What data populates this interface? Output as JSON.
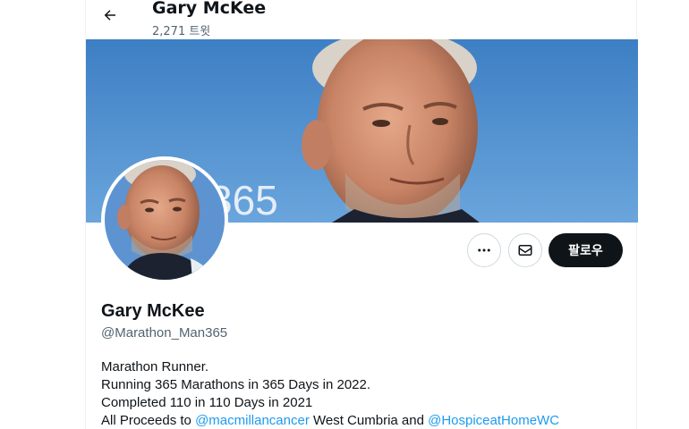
{
  "header": {
    "name": "Gary McKee",
    "tweet_count": "2,271 트윗"
  },
  "banner": {
    "overlay_text": "365"
  },
  "actions": {
    "more_icon": "more-horizontal-icon",
    "message_icon": "envelope-icon",
    "follow_label": "팔로우"
  },
  "profile": {
    "name": "Gary McKee",
    "handle": "@Marathon_Man365"
  },
  "bio": {
    "line1": "Marathon Runner.",
    "line2": "Running 365 Marathons in 365 Days in 2022.",
    "line3": "Completed 110 in 110 Days in 2021",
    "line4_prefix": "All Proceeds to ",
    "line4_mention1": "@macmillancancer",
    "line4_middle": " West Cumbria and ",
    "line4_mention2": "@HospiceatHomeWC"
  },
  "colors": {
    "link": "#1d9bf0",
    "text_primary": "#0f1419",
    "text_secondary": "#536471",
    "sky": "#4a86c8",
    "follow_button": "#0f1419"
  }
}
